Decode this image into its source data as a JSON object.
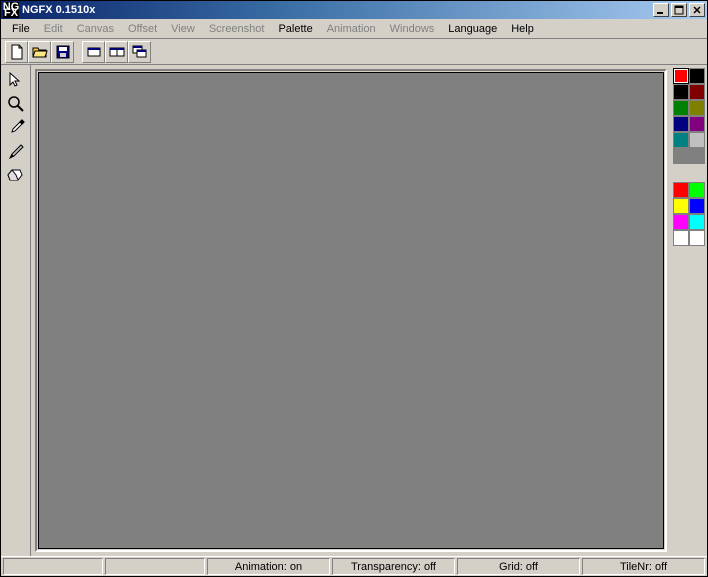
{
  "title": "NGFX 0.1510x",
  "logo": {
    "line1": "NG",
    "line2": "FX"
  },
  "menu": [
    {
      "label": "File",
      "active": true
    },
    {
      "label": "Edit",
      "active": false
    },
    {
      "label": "Canvas",
      "active": false
    },
    {
      "label": "Offset",
      "active": false
    },
    {
      "label": "View",
      "active": false
    },
    {
      "label": "Screenshot",
      "active": false
    },
    {
      "label": "Palette",
      "active": true
    },
    {
      "label": "Animation",
      "active": false
    },
    {
      "label": "Windows",
      "active": false
    },
    {
      "label": "Language",
      "active": true
    },
    {
      "label": "Help",
      "active": true
    }
  ],
  "toolbar": {
    "new": "new",
    "open": "open",
    "save": "save",
    "win1": "win1",
    "win2": "win2",
    "win3": "win3"
  },
  "tools": {
    "select": "select",
    "zoom": "zoom",
    "picker": "picker",
    "brush": "brush",
    "eraser": "eraser"
  },
  "palette_top": [
    [
      "#ff0000",
      "#000000"
    ],
    [
      "#000000",
      "#800000"
    ],
    [
      "#008000",
      "#808000"
    ],
    [
      "#000080",
      "#800080"
    ],
    [
      "#008080",
      "#c0c0c0"
    ],
    [
      "#808080",
      "#808080"
    ]
  ],
  "palette_bottom": [
    [
      "#ff0000",
      "#00ff00"
    ],
    [
      "#ffff00",
      "#0000ff"
    ],
    [
      "#ff00ff",
      "#00ffff"
    ],
    [
      "#ffffff",
      "#ffffff"
    ]
  ],
  "status": {
    "animation": "Animation: on",
    "transparency": "Transparency: off",
    "grid": "Grid: off",
    "tilenr": "TileNr: off"
  }
}
